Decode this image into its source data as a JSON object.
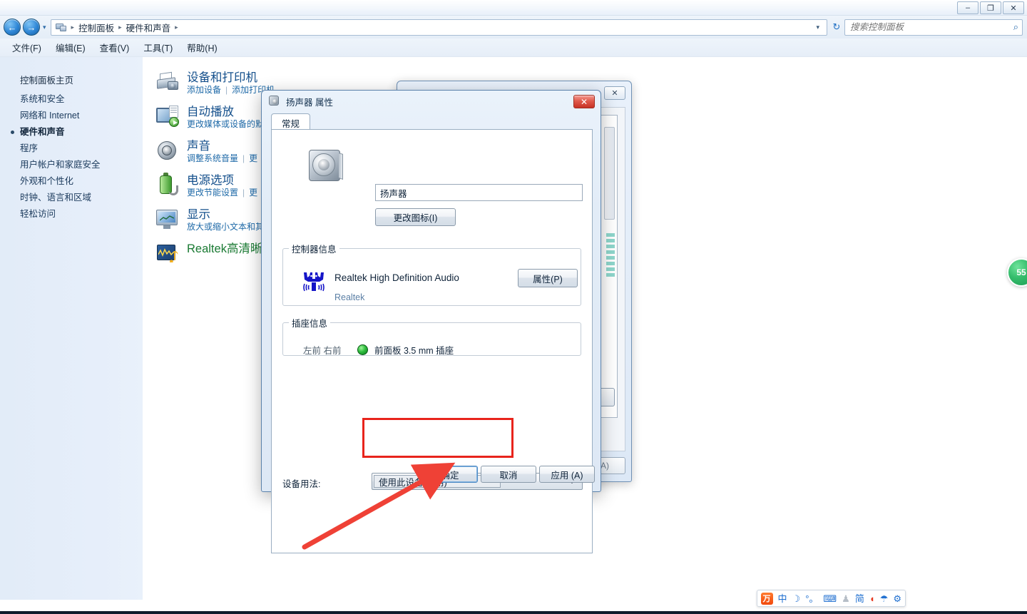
{
  "window": {
    "minimize_label": "–",
    "maximize_label": "❐",
    "close_label": "✕"
  },
  "addressbar": {
    "back_label": "←",
    "forward_label": "→",
    "history_label": "▾",
    "crumbs": [
      "控制面板",
      "硬件和声音"
    ],
    "separator": "▸",
    "dropdown_caret": "▾",
    "refresh_label": "↻",
    "search_placeholder": "搜索控制面板",
    "search_value": "",
    "search_icon": "⌕"
  },
  "menubar": {
    "items": [
      "文件(F)",
      "编辑(E)",
      "查看(V)",
      "工具(T)",
      "帮助(H)"
    ]
  },
  "sidebar": {
    "home": "控制面板主页",
    "items": [
      {
        "label": "系统和安全",
        "active": false
      },
      {
        "label": "网络和 Internet",
        "active": false
      },
      {
        "label": "硬件和声音",
        "active": true
      },
      {
        "label": "程序",
        "active": false
      },
      {
        "label": "用户帐户和家庭安全",
        "active": false
      },
      {
        "label": "外观和个性化",
        "active": false
      },
      {
        "label": "时钟、语言和区域",
        "active": false
      },
      {
        "label": "轻松访问",
        "active": false
      }
    ]
  },
  "categories": [
    {
      "title": "设备和打印机",
      "links": [
        "添加设备",
        "添加打印机"
      ],
      "icon": "printer-icon",
      "title_color": "blue"
    },
    {
      "title": "自动播放",
      "links": [
        "更改媒体或设备的默"
      ],
      "icon": "autoplay-icon",
      "title_color": "blue"
    },
    {
      "title": "声音",
      "links": [
        "调整系统音量",
        "更"
      ],
      "icon": "sound-icon",
      "title_color": "blue"
    },
    {
      "title": "电源选项",
      "links": [
        "更改节能设置",
        "更"
      ],
      "icon": "power-icon",
      "title_color": "blue"
    },
    {
      "title": "显示",
      "links": [
        "放大或缩小文本和其"
      ],
      "icon": "display-icon",
      "title_color": "blue"
    },
    {
      "title": "Realtek高清晰",
      "links": [],
      "icon": "realtek-icon",
      "title_color": "green"
    }
  ],
  "background_dialog": {
    "close_label": "✕",
    "apply_label": "(A)"
  },
  "dialog": {
    "title": "扬声器 属性",
    "icon": "speaker-icon",
    "close_label": "✕",
    "tab": "常规",
    "device_name": "扬声器",
    "change_icon_button": "更改图标(I)",
    "controller_group": {
      "legend": "控制器信息",
      "name": "Realtek High Definition Audio",
      "vendor": "Realtek",
      "properties_button": "属性(P)"
    },
    "jack_group": {
      "legend": "插座信息",
      "channels": "左前 右前",
      "jack_label": "前面板 3.5 mm 插座",
      "indicator_color": "#2fbd3e"
    },
    "device_usage": {
      "label": "设备用法:",
      "value": "使用此设备(启用)",
      "arrow": "▾"
    },
    "buttons": {
      "ok": "确定",
      "cancel": "取消",
      "apply": "应用 (A)"
    }
  },
  "annotations": {
    "highlight_color": "#e8241c",
    "arrow_color": "#ef4136"
  },
  "badge": {
    "text": "55"
  },
  "ime": {
    "logo": "万",
    "items": [
      "中",
      "☽",
      "°。",
      "⌨",
      "♟",
      "简",
      "◖",
      "☂",
      "⚙"
    ]
  }
}
